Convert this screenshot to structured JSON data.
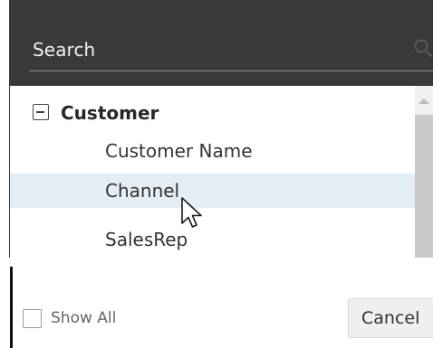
{
  "search": {
    "label": "Search",
    "icon": "search-icon"
  },
  "tree": {
    "group": {
      "label": "Customer",
      "expanded": true,
      "icon": "collapse-minus-icon"
    },
    "items": [
      {
        "label": "Customer Name",
        "hovered": false
      },
      {
        "label": "Channel",
        "hovered": true
      },
      {
        "label": "SalesRep",
        "hovered": false
      }
    ]
  },
  "footer": {
    "show_all_label": "Show All",
    "show_all_checked": false,
    "cancel_label": "Cancel"
  },
  "colors": {
    "header_bg": "#3a3a3a",
    "hover_row_bg": "#e3edf5",
    "scroll_thumb": "#c8c8c8"
  },
  "cursor": {
    "icon": "arrow-pointer-icon"
  }
}
